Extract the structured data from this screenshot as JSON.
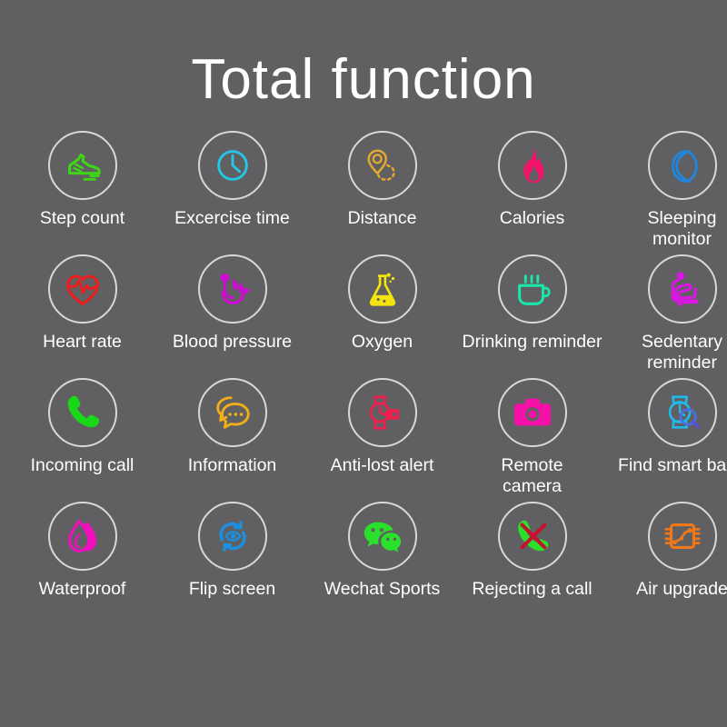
{
  "header": {
    "title": "Total function"
  },
  "theme": {
    "background": "#606063",
    "circle_stroke": "#d8d8da",
    "label_color": "#ffffff"
  },
  "features": [
    {
      "label": "Step count",
      "icon": "running-shoe-icon",
      "color": "#3DD615"
    },
    {
      "label": "Excercise time",
      "icon": "clock-icon",
      "color": "#23C8E8"
    },
    {
      "label": "Distance",
      "icon": "map-pin-route-icon",
      "color": "#E5A82E"
    },
    {
      "label": "Calories",
      "icon": "flame-icon",
      "color": "#F5136B"
    },
    {
      "label": "Sleeping\nmonitor",
      "icon": "crescent-moon-icon",
      "color": "#1F85DD"
    },
    {
      "label": "Heart rate",
      "icon": "heart-pulse-icon",
      "color": "#EE1C1C"
    },
    {
      "label": "Blood pressure",
      "icon": "blood-pressure-icon",
      "color": "#CE0BD2"
    },
    {
      "label": "Oxygen",
      "icon": "flask-icon",
      "color": "#F2E40C"
    },
    {
      "label": "Drinking reminder",
      "icon": "coffee-cup-icon",
      "color": "#19E6A8"
    },
    {
      "label": "Sedentary\nreminder",
      "icon": "sitting-person-icon",
      "color": "#D916E2"
    },
    {
      "label": "Incoming call",
      "icon": "phone-handset-icon",
      "color": "#18D818"
    },
    {
      "label": "Information",
      "icon": "chat-bubbles-icon",
      "color": "#F2AE18"
    },
    {
      "label": "Anti-lost alert",
      "icon": "watch-tag-icon",
      "color": "#EE2050"
    },
    {
      "label": "Remote\ncamera",
      "icon": "camera-icon",
      "color": "#F511A8"
    },
    {
      "label": "Find smart band",
      "icon": "watch-search-icon",
      "color": "#22B8E8"
    },
    {
      "label": "Waterproof",
      "icon": "water-drop-icon",
      "color": "#EE11BB"
    },
    {
      "label": "Flip screen",
      "icon": "flip-screen-eye-icon",
      "color": "#1C8FE0"
    },
    {
      "label": "Wechat Sports",
      "icon": "wechat-icon",
      "color": "#2BE02B"
    },
    {
      "label": "Rejecting a call",
      "icon": "call-reject-icon",
      "color": "#2BE02B"
    },
    {
      "label": "Air upgrade",
      "icon": "chip-upgrade-icon",
      "color": "#F07818"
    }
  ]
}
